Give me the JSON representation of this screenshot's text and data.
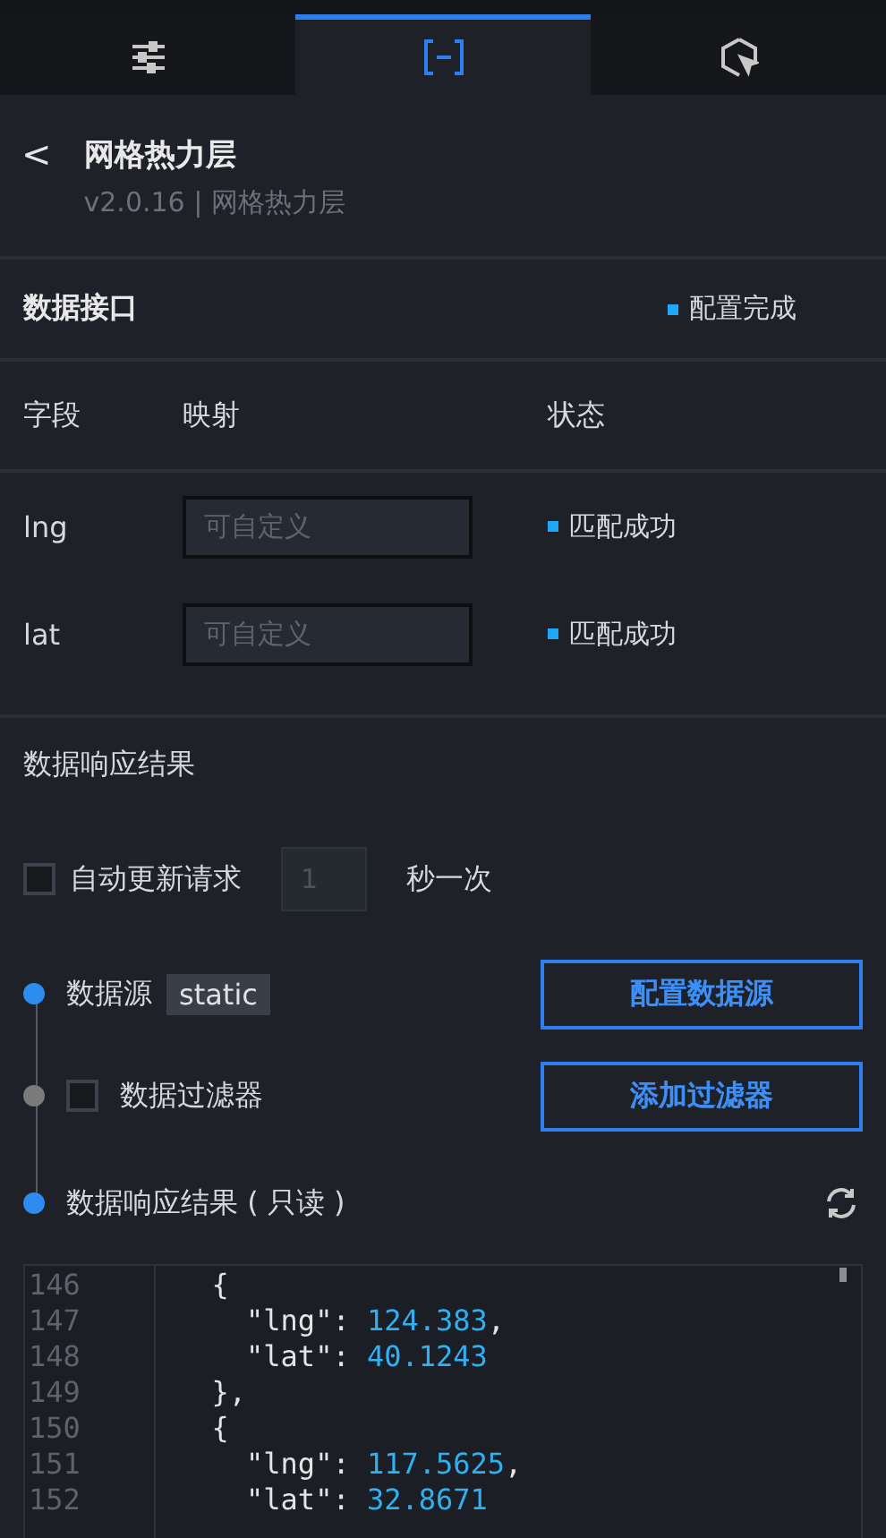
{
  "tabs": [
    {
      "selected": false
    },
    {
      "selected": true
    },
    {
      "selected": false
    }
  ],
  "header": {
    "back": "<",
    "title": "网格热力层",
    "subtitle": "v2.0.16 | 网格热力层"
  },
  "data_interface": {
    "title": "数据接口",
    "status": "配置完成"
  },
  "mapping": {
    "columns": [
      "字段",
      "映射",
      "状态"
    ],
    "rows": [
      {
        "field": "lng",
        "placeholder": "可自定义",
        "status": "匹配成功"
      },
      {
        "field": "lat",
        "placeholder": "可自定义",
        "status": "匹配成功"
      }
    ]
  },
  "response_section": {
    "title": "数据响应结果"
  },
  "auto_update": {
    "checked": false,
    "label": "自动更新请求",
    "placeholder": "1",
    "unit": "秒一次"
  },
  "steps": [
    {
      "kind": "source",
      "color": "#2d8cf0",
      "label": "数据源",
      "tag": "static",
      "button": "配置数据源"
    },
    {
      "kind": "filter",
      "color": "#7a7a7a",
      "checked": false,
      "label": "数据过滤器",
      "button": "添加过滤器"
    },
    {
      "kind": "result",
      "color": "#2d8cf0",
      "label": "数据响应结果 ( 只读 )"
    }
  ],
  "code": [
    {
      "number": "146",
      "kind": "punct",
      "text": "  {"
    },
    {
      "number": "147",
      "kind": "pair",
      "key": "    \"lng\": ",
      "value": "124.383",
      "trailing": ","
    },
    {
      "number": "148",
      "kind": "pair",
      "key": "    \"lat\": ",
      "value": "40.1243"
    },
    {
      "number": "149",
      "kind": "punct",
      "text": "  },"
    },
    {
      "number": "150",
      "kind": "punct",
      "text": "  {"
    },
    {
      "number": "151",
      "kind": "pair",
      "key": "    \"lng\": ",
      "value": "117.5625",
      "trailing": ","
    },
    {
      "number": "152",
      "kind": "pair",
      "key": "    \"lat\": ",
      "value": "32.8671"
    }
  ]
}
